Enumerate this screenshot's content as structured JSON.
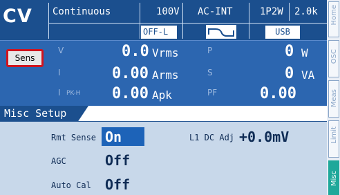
{
  "status": {
    "mode": "CV",
    "output_mode": "Continuous",
    "range": "100V",
    "signal_source": "AC-INT",
    "phase": "1P2W",
    "scale": "2.0k",
    "output_state": "OFF-L",
    "interface": "USB",
    "waveform_icon": "sine-wave-icon"
  },
  "sens_button": "Sens",
  "measurements": {
    "v_label": "V",
    "v_value": "0.0",
    "v_unit": "Vrms",
    "i_label": "I",
    "i_value": "0.00",
    "i_unit": "Arms",
    "ipk_label": "I",
    "ipk_sub": "PK-H",
    "ipk_value": "0.00",
    "ipk_unit": "Apk",
    "p_label": "P",
    "p_value": "0",
    "p_unit": "W",
    "s_label": "S",
    "s_value": "0",
    "s_unit": "VA",
    "pf_label": "PF",
    "pf_value": "0.00"
  },
  "misc": {
    "title": "Misc Setup",
    "rmt_sense_label": "Rmt Sense",
    "rmt_sense_value": "On",
    "agc_label": "AGC",
    "agc_value": "Off",
    "auto_cal_label": "Auto Cal",
    "auto_cal_value": "Off",
    "l1_dc_adj_label": "L1 DC Adj",
    "l1_dc_adj_value": "+0.0mV"
  },
  "side_tabs": [
    "Home",
    "OSC",
    "Meas",
    "Limit",
    "Misc"
  ],
  "colors": {
    "background": "#1b4f8e",
    "measurement_bg": "#2c66b0",
    "panel_bg": "#c8d8ea",
    "selection": "#1d63b8",
    "highlight_border": "#d0141e",
    "active_tab": "#1fa89a"
  }
}
